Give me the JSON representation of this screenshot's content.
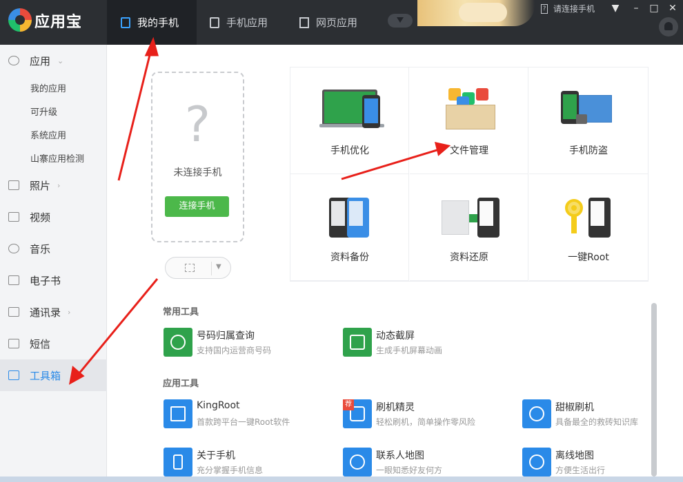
{
  "app": {
    "brand": "应用宝"
  },
  "nav": {
    "tabs": [
      {
        "label": "我的手机",
        "active": true
      },
      {
        "label": "手机应用"
      },
      {
        "label": "网页应用"
      }
    ]
  },
  "header": {
    "connect_status": "请连接手机",
    "window_buttons": {
      "menu": "▼",
      "minimize": "–",
      "maximize": "□",
      "close": "✕"
    }
  },
  "sidebar": {
    "items": [
      {
        "label": "应用",
        "icon": "app-icon",
        "chevron": "⌄"
      },
      {
        "label": "照片",
        "icon": "photo-icon",
        "chevron": "›"
      },
      {
        "label": "视频",
        "icon": "video-icon"
      },
      {
        "label": "音乐",
        "icon": "music-icon"
      },
      {
        "label": "电子书",
        "icon": "book-icon"
      },
      {
        "label": "通讯录",
        "icon": "contacts-icon",
        "chevron": "›"
      },
      {
        "label": "短信",
        "icon": "sms-icon"
      },
      {
        "label": "工具箱",
        "icon": "toolbox-icon",
        "active": true
      }
    ],
    "subitems": [
      "我的应用",
      "可升级",
      "系统应用",
      "山寨应用检测"
    ]
  },
  "phone": {
    "placeholder": "?",
    "status": "未连接手机",
    "connect_button": "连接手机"
  },
  "tools": [
    {
      "label": "手机优化"
    },
    {
      "label": "文件管理"
    },
    {
      "label": "手机防盗"
    },
    {
      "label": "资料备份"
    },
    {
      "label": "资料还原"
    },
    {
      "label": "一键Root"
    }
  ],
  "common_tools": {
    "title": "常用工具",
    "items": [
      {
        "name": "号码归属查询",
        "desc": "支持国内运营商号码",
        "color": "#2fa24b"
      },
      {
        "name": "动态截屏",
        "desc": "生成手机屏幕动画",
        "color": "#2fa24b"
      }
    ]
  },
  "app_tools": {
    "title": "应用工具",
    "items": [
      {
        "name": "KingRoot",
        "desc": "首款跨平台一键Root软件",
        "color": "#2a8ae8"
      },
      {
        "name": "刷机精灵",
        "desc": "轻松刷机，简单操作零风险",
        "color": "#2a8ae8",
        "badge": "荐"
      },
      {
        "name": "甜椒刷机",
        "desc": "具备最全的救砖知识库",
        "color": "#2a8ae8"
      },
      {
        "name": "关于手机",
        "desc": "充分掌握手机信息",
        "color": "#2a8ae8"
      },
      {
        "name": "联系人地图",
        "desc": "一眼知悉好友何方",
        "color": "#2a8ae8"
      },
      {
        "name": "离线地图",
        "desc": "方便生活出行",
        "color": "#2a8ae8"
      }
    ]
  },
  "colors": {
    "accent": "#2a8ae8",
    "green": "#4cb84a",
    "annotation": "#e8201a"
  }
}
